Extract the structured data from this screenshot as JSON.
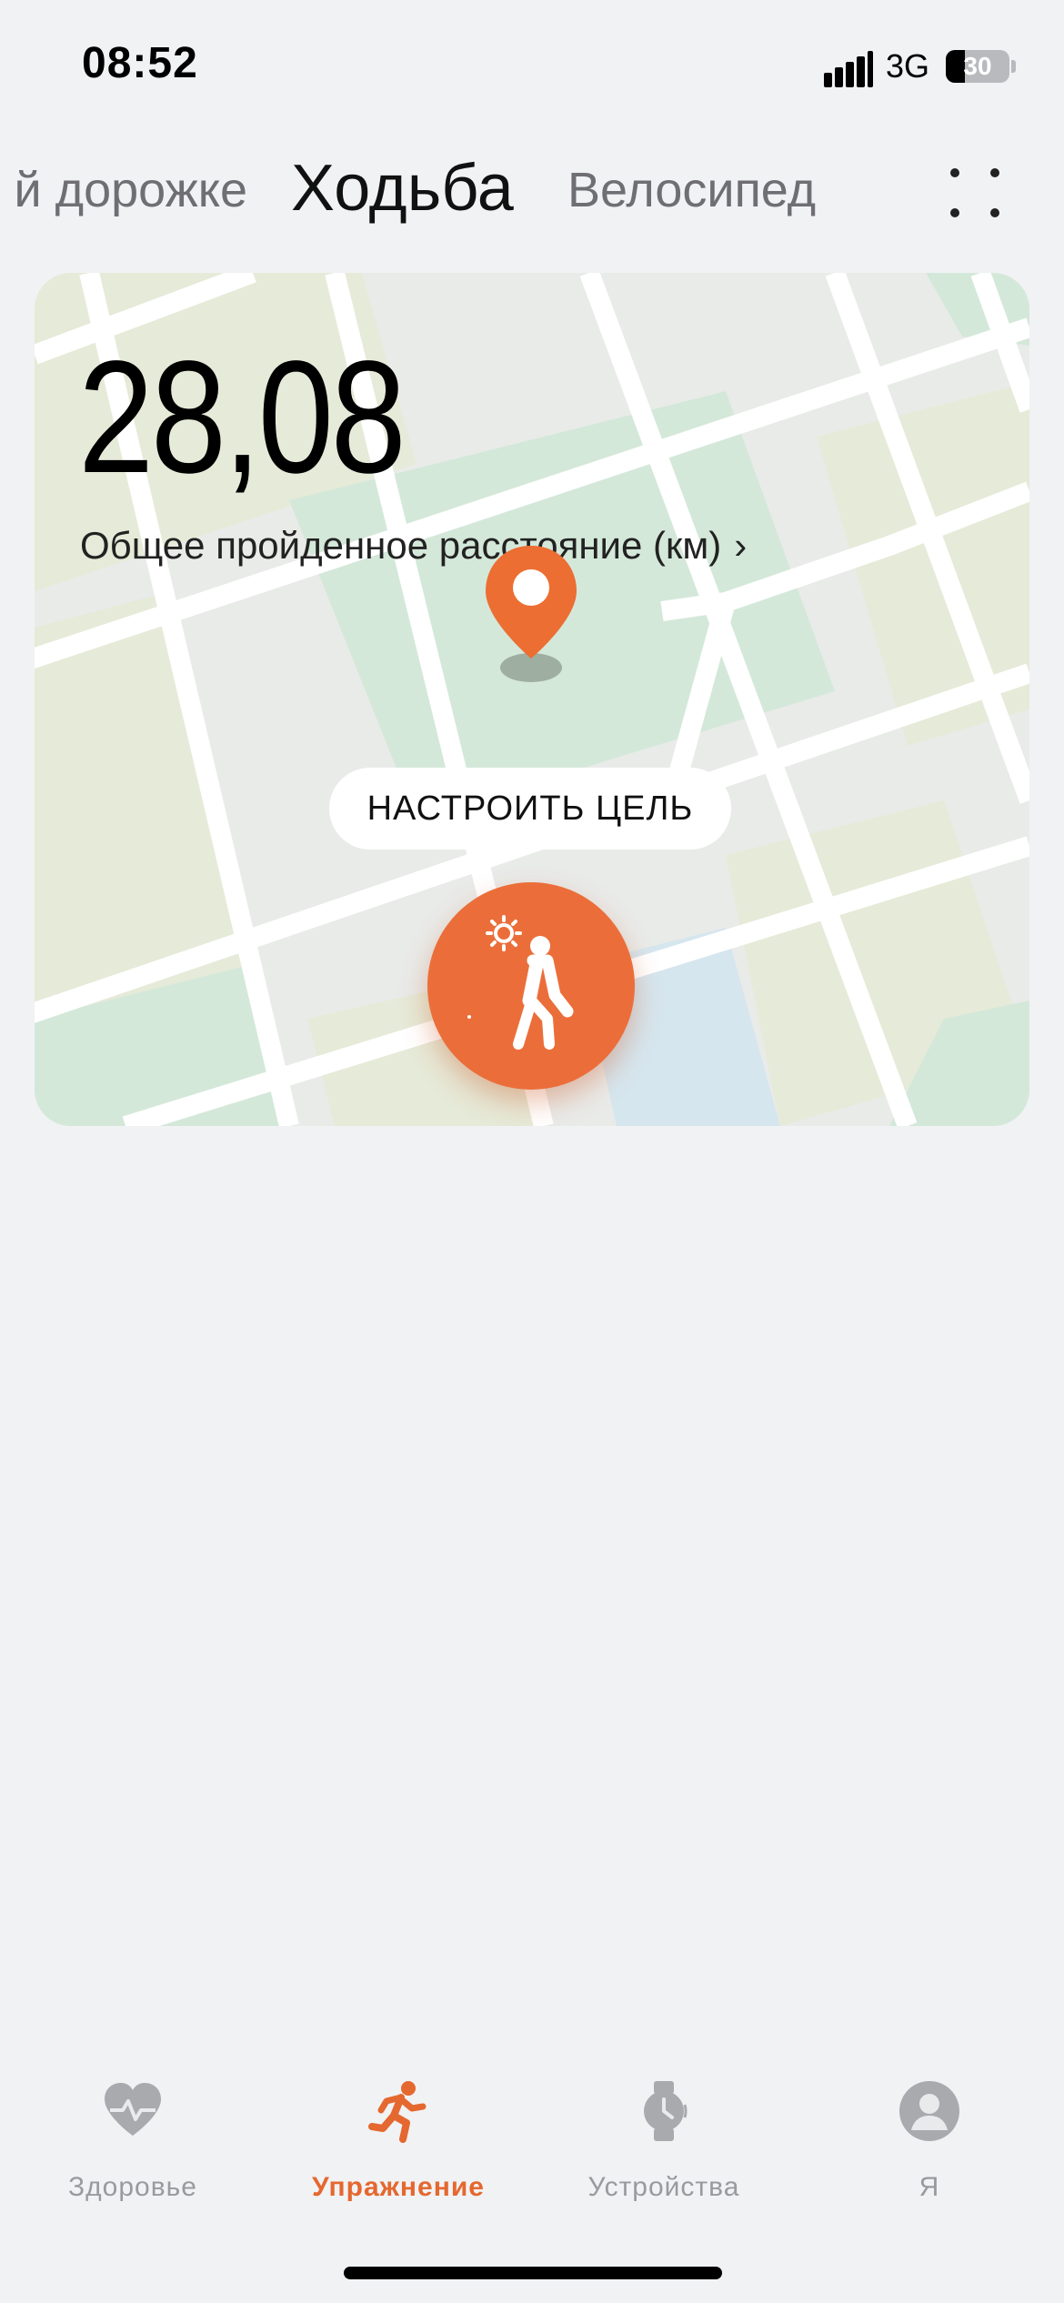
{
  "status_bar": {
    "time": "08:52",
    "network": "3G",
    "battery": "30",
    "battery_level_percent": 30
  },
  "tabs": {
    "previous": "й дорожке",
    "active": "Ходьба",
    "next": "Велосипед",
    "more_icon": "grid-dots-icon"
  },
  "card": {
    "distance_value": "28,08",
    "distance_label": "Общее пройденное расстояние (км)",
    "goal_button": "НАСТРОИТЬ ЦЕЛЬ",
    "start_icon": "walking-person-icon"
  },
  "bottom_nav": {
    "items": [
      {
        "label": "Здоровье",
        "icon": "heart-pulse-icon"
      },
      {
        "label": "Упражнение",
        "icon": "running-icon"
      },
      {
        "label": "Устройства",
        "icon": "watch-icon"
      },
      {
        "label": "Я",
        "icon": "profile-icon"
      }
    ]
  },
  "colors": {
    "accent": "#eb6e3a",
    "active_nav": "#e4682f",
    "background": "#f1f2f4"
  }
}
